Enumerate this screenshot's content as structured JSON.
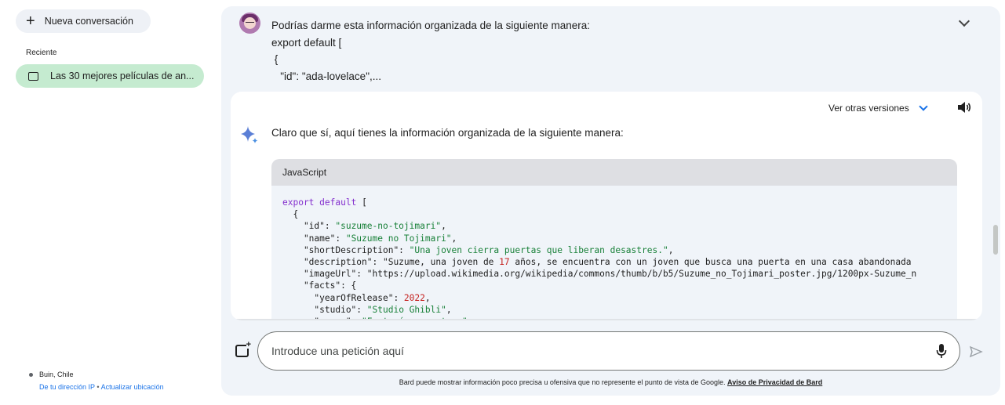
{
  "sidebar": {
    "new_chat_label": "Nueva conversación",
    "recent_label": "Reciente",
    "recent_items": [
      {
        "label": "Las 30 mejores películas de an..."
      }
    ],
    "location": {
      "place": "Buin, Chile",
      "ip_link": "De tu dirección IP",
      "separator": "•",
      "update_link": "Actualizar ubicación"
    }
  },
  "conversation": {
    "user_message_lines": [
      "Podrías darme esta información organizada de la siguiente manera:",
      "export default [",
      " {",
      "   \"id\": \"ada-lovelace\",..."
    ],
    "response": {
      "versions_label": "Ver otras versiones",
      "intro_text": "Claro que sí, aquí tienes la información organizada de la siguiente manera:",
      "code_language": "JavaScript",
      "code_lines": [
        "export default [",
        "  {",
        "    \"id\": \"suzume-no-tojimari\",",
        "    \"name\": \"Suzume no Tojimari\",",
        "    \"shortDescription\": \"Una joven cierra puertas que liberan desastres.\",",
        "    \"description\": \"Suzume, una joven de 17 años, se encuentra con un joven que busca una puerta en una casa abandonada",
        "    \"imageUrl\": \"https://upload.wikimedia.org/wikipedia/commons/thumb/b/b5/Suzume_no_Tojimari_poster.jpg/1200px-Suzume_n",
        "    \"facts\": {",
        "      \"yearOfRelease\": 2022,",
        "      \"studio\": \"Studio Ghibli\",",
        "      \"genre\": \"Fantasía, aventura\","
      ]
    }
  },
  "input": {
    "placeholder": "Introduce una petición aquí"
  },
  "footer": {
    "disclaimer": "Bard puede mostrar información poco precisa u ofensiva que no represente el punto de vista de Google.",
    "privacy_link": "Aviso de Privacidad de Bard"
  },
  "colors": {
    "main_bg": "#f0f4f9",
    "recent_item_bg": "#c5ebd0",
    "keyword": "#8430ce",
    "string": "#188038",
    "number": "#c5221f",
    "link": "#1a73e8"
  },
  "icons": [
    "plus-icon",
    "chat-bubble-icon",
    "location-dot-icon",
    "chevron-down-icon",
    "speaker-icon",
    "bard-sparkle-icon",
    "add-image-icon",
    "microphone-icon",
    "send-icon"
  ]
}
